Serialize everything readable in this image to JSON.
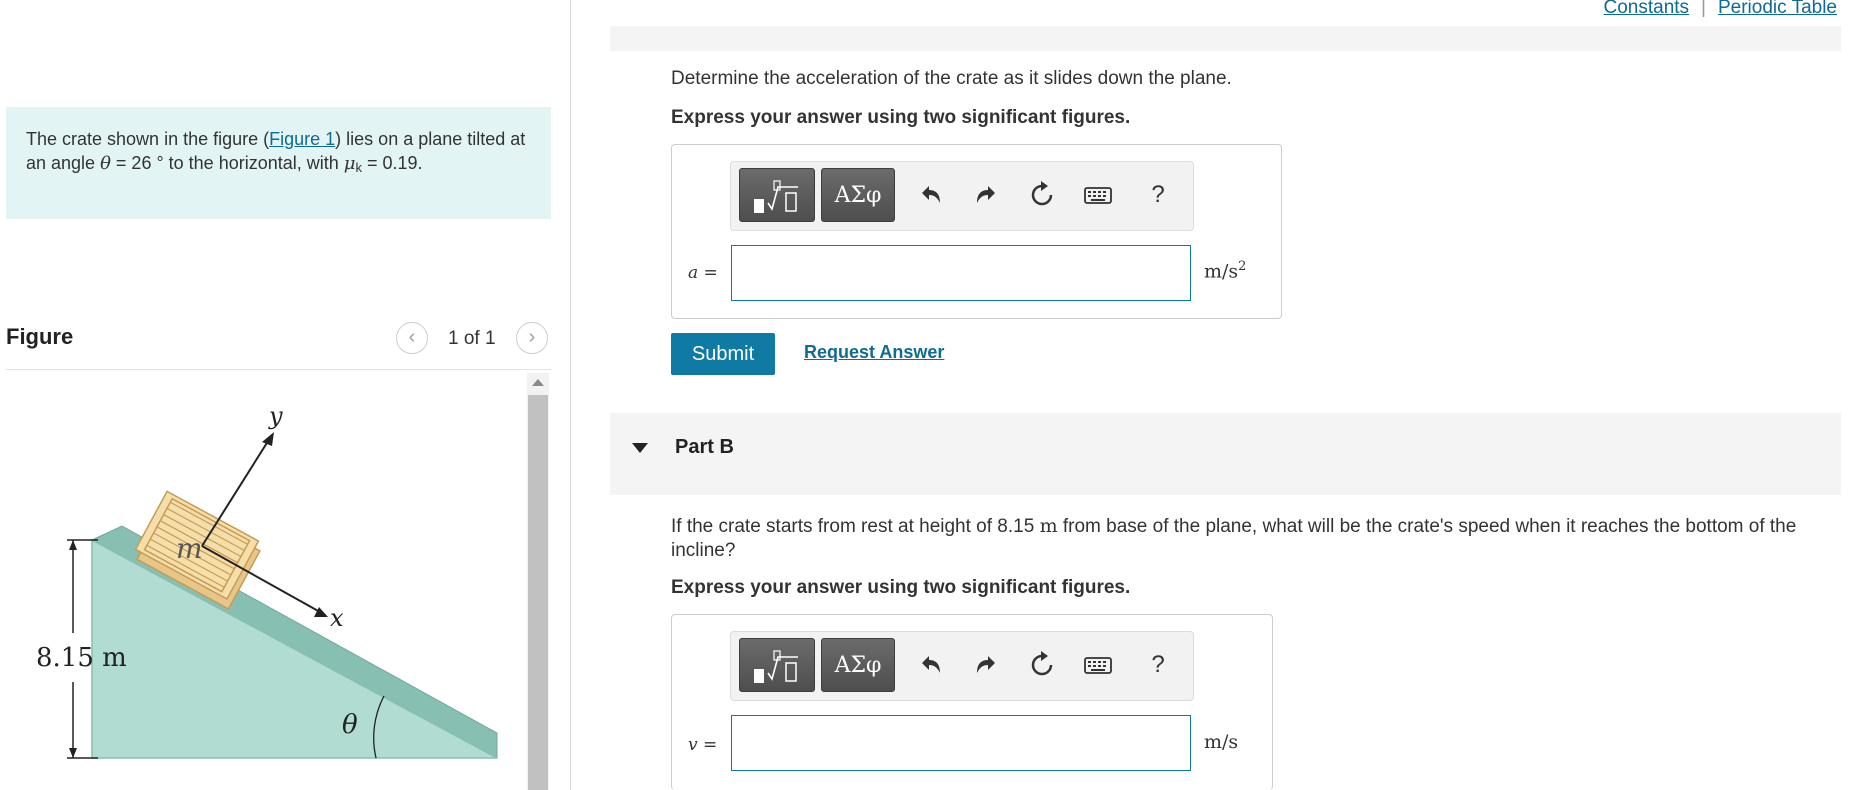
{
  "header": {
    "constants_link": "Constants",
    "separator": "|",
    "periodic_table_link": "Periodic Table"
  },
  "problem": {
    "text_1": "The crate shown in the figure (",
    "figure_link": "Figure 1",
    "text_2": ") lies on a plane tilted at an angle ",
    "theta_symbol": "θ",
    "text_3": " = 26 ° to the horizontal, with ",
    "mu_symbol": "μ",
    "mu_subscript": "k",
    "text_4": " = 0.19."
  },
  "figure_panel": {
    "title": "Figure",
    "page_count": "1 of 1",
    "prev_glyph": "‹",
    "next_glyph": "›",
    "labels": {
      "y_axis": "y",
      "x_axis": "x",
      "mass": "m",
      "height": "8.15 m",
      "angle": "θ"
    },
    "colors": {
      "incline_fill": "#b1dcd2",
      "incline_edge": "#87bfb2",
      "crate_fill": "#f6deaa",
      "crate_edge": "#c59c55"
    }
  },
  "part_a": {
    "question": "Determine the acceleration of the crate as it slides down the plane.",
    "instruction": "Express your answer using two significant figures.",
    "variable": "a",
    "equals": " =",
    "input_value": "",
    "unit_base": "m/s",
    "unit_exp": "2",
    "submit_label": "Submit",
    "request_label": "Request Answer"
  },
  "part_b": {
    "title": "Part B",
    "question_1": "If the crate starts from rest at height of 8.15 ",
    "question_unit": "m",
    "question_2": " from base of the plane, what will be the crate's speed when it reaches the bottom of the incline?",
    "instruction": "Express your answer using two significant figures.",
    "variable": "v",
    "equals": " =",
    "input_value": "",
    "unit": "m/s"
  },
  "toolbar": {
    "greek_label": "ΑΣφ",
    "undo_icon": "undo-icon",
    "redo_icon": "redo-icon",
    "reset_icon": "reset-icon",
    "keyboard_icon": "keyboard-icon",
    "help_label": "?"
  },
  "theme": {
    "accent": "#0f7aa3",
    "link": "#0d6b94",
    "problem_bg": "#e3f4f4"
  }
}
